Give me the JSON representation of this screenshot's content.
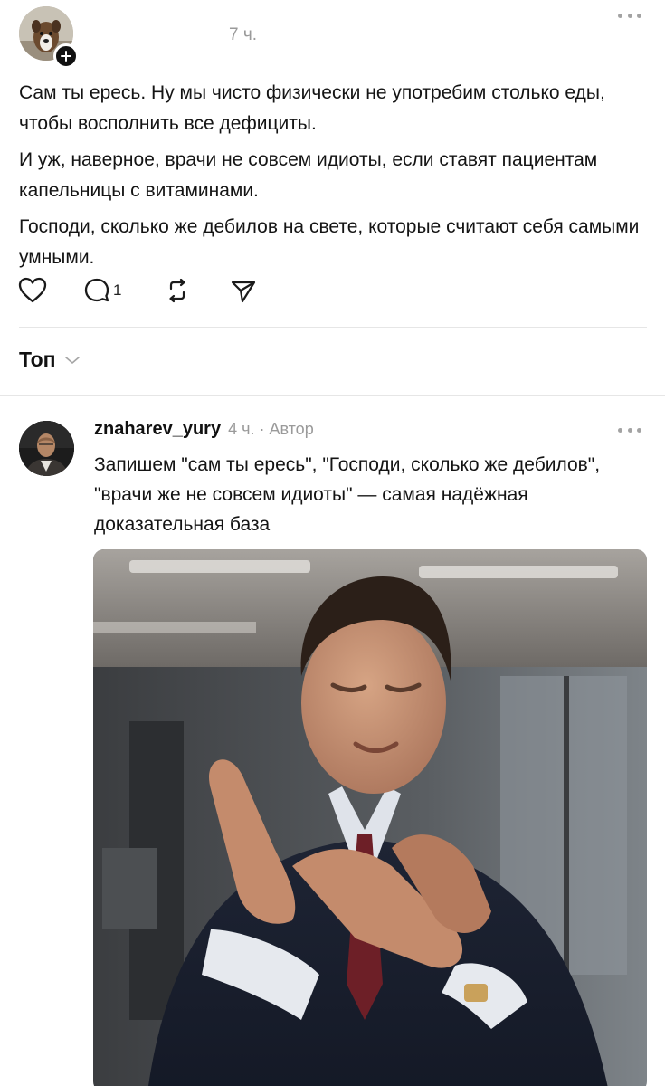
{
  "post": {
    "time": "7 ч.",
    "paragraphs": [
      "Сам ты ересь. Ну мы чисто физически не употребим столько еды, чтобы восполнить все дефициты.",
      "И уж, наверное, врачи не совсем идиоты, если ставят пациентам капельницы с витаминами.",
      "Господи, сколько же дебилов на свете, которые считают себя самыми умными."
    ],
    "reply_count": "1"
  },
  "sort": {
    "label": "Топ"
  },
  "comment": {
    "username": "znaharev_yury",
    "time": "4 ч.",
    "separator": "·",
    "role": "Автор",
    "text": "Запишем \"сам ты ересь\", \"Господи, сколько же дебилов\", \"врачи же не совсем идиоты\" — самая надёжная доказательная база"
  },
  "icons": {
    "post_avatar": "dog-avatar",
    "follow": "plus-icon",
    "more": "more-dots-icon",
    "like": "heart-icon",
    "reply": "comment-bubble-icon",
    "repost": "repost-icon",
    "share": "send-icon",
    "sort": "chevron-down-icon",
    "comment_avatar": "user-avatar"
  },
  "colors": {
    "text": "#141414",
    "muted": "#9a9a9a",
    "divider": "#e6e6e6",
    "background": "#ffffff"
  }
}
